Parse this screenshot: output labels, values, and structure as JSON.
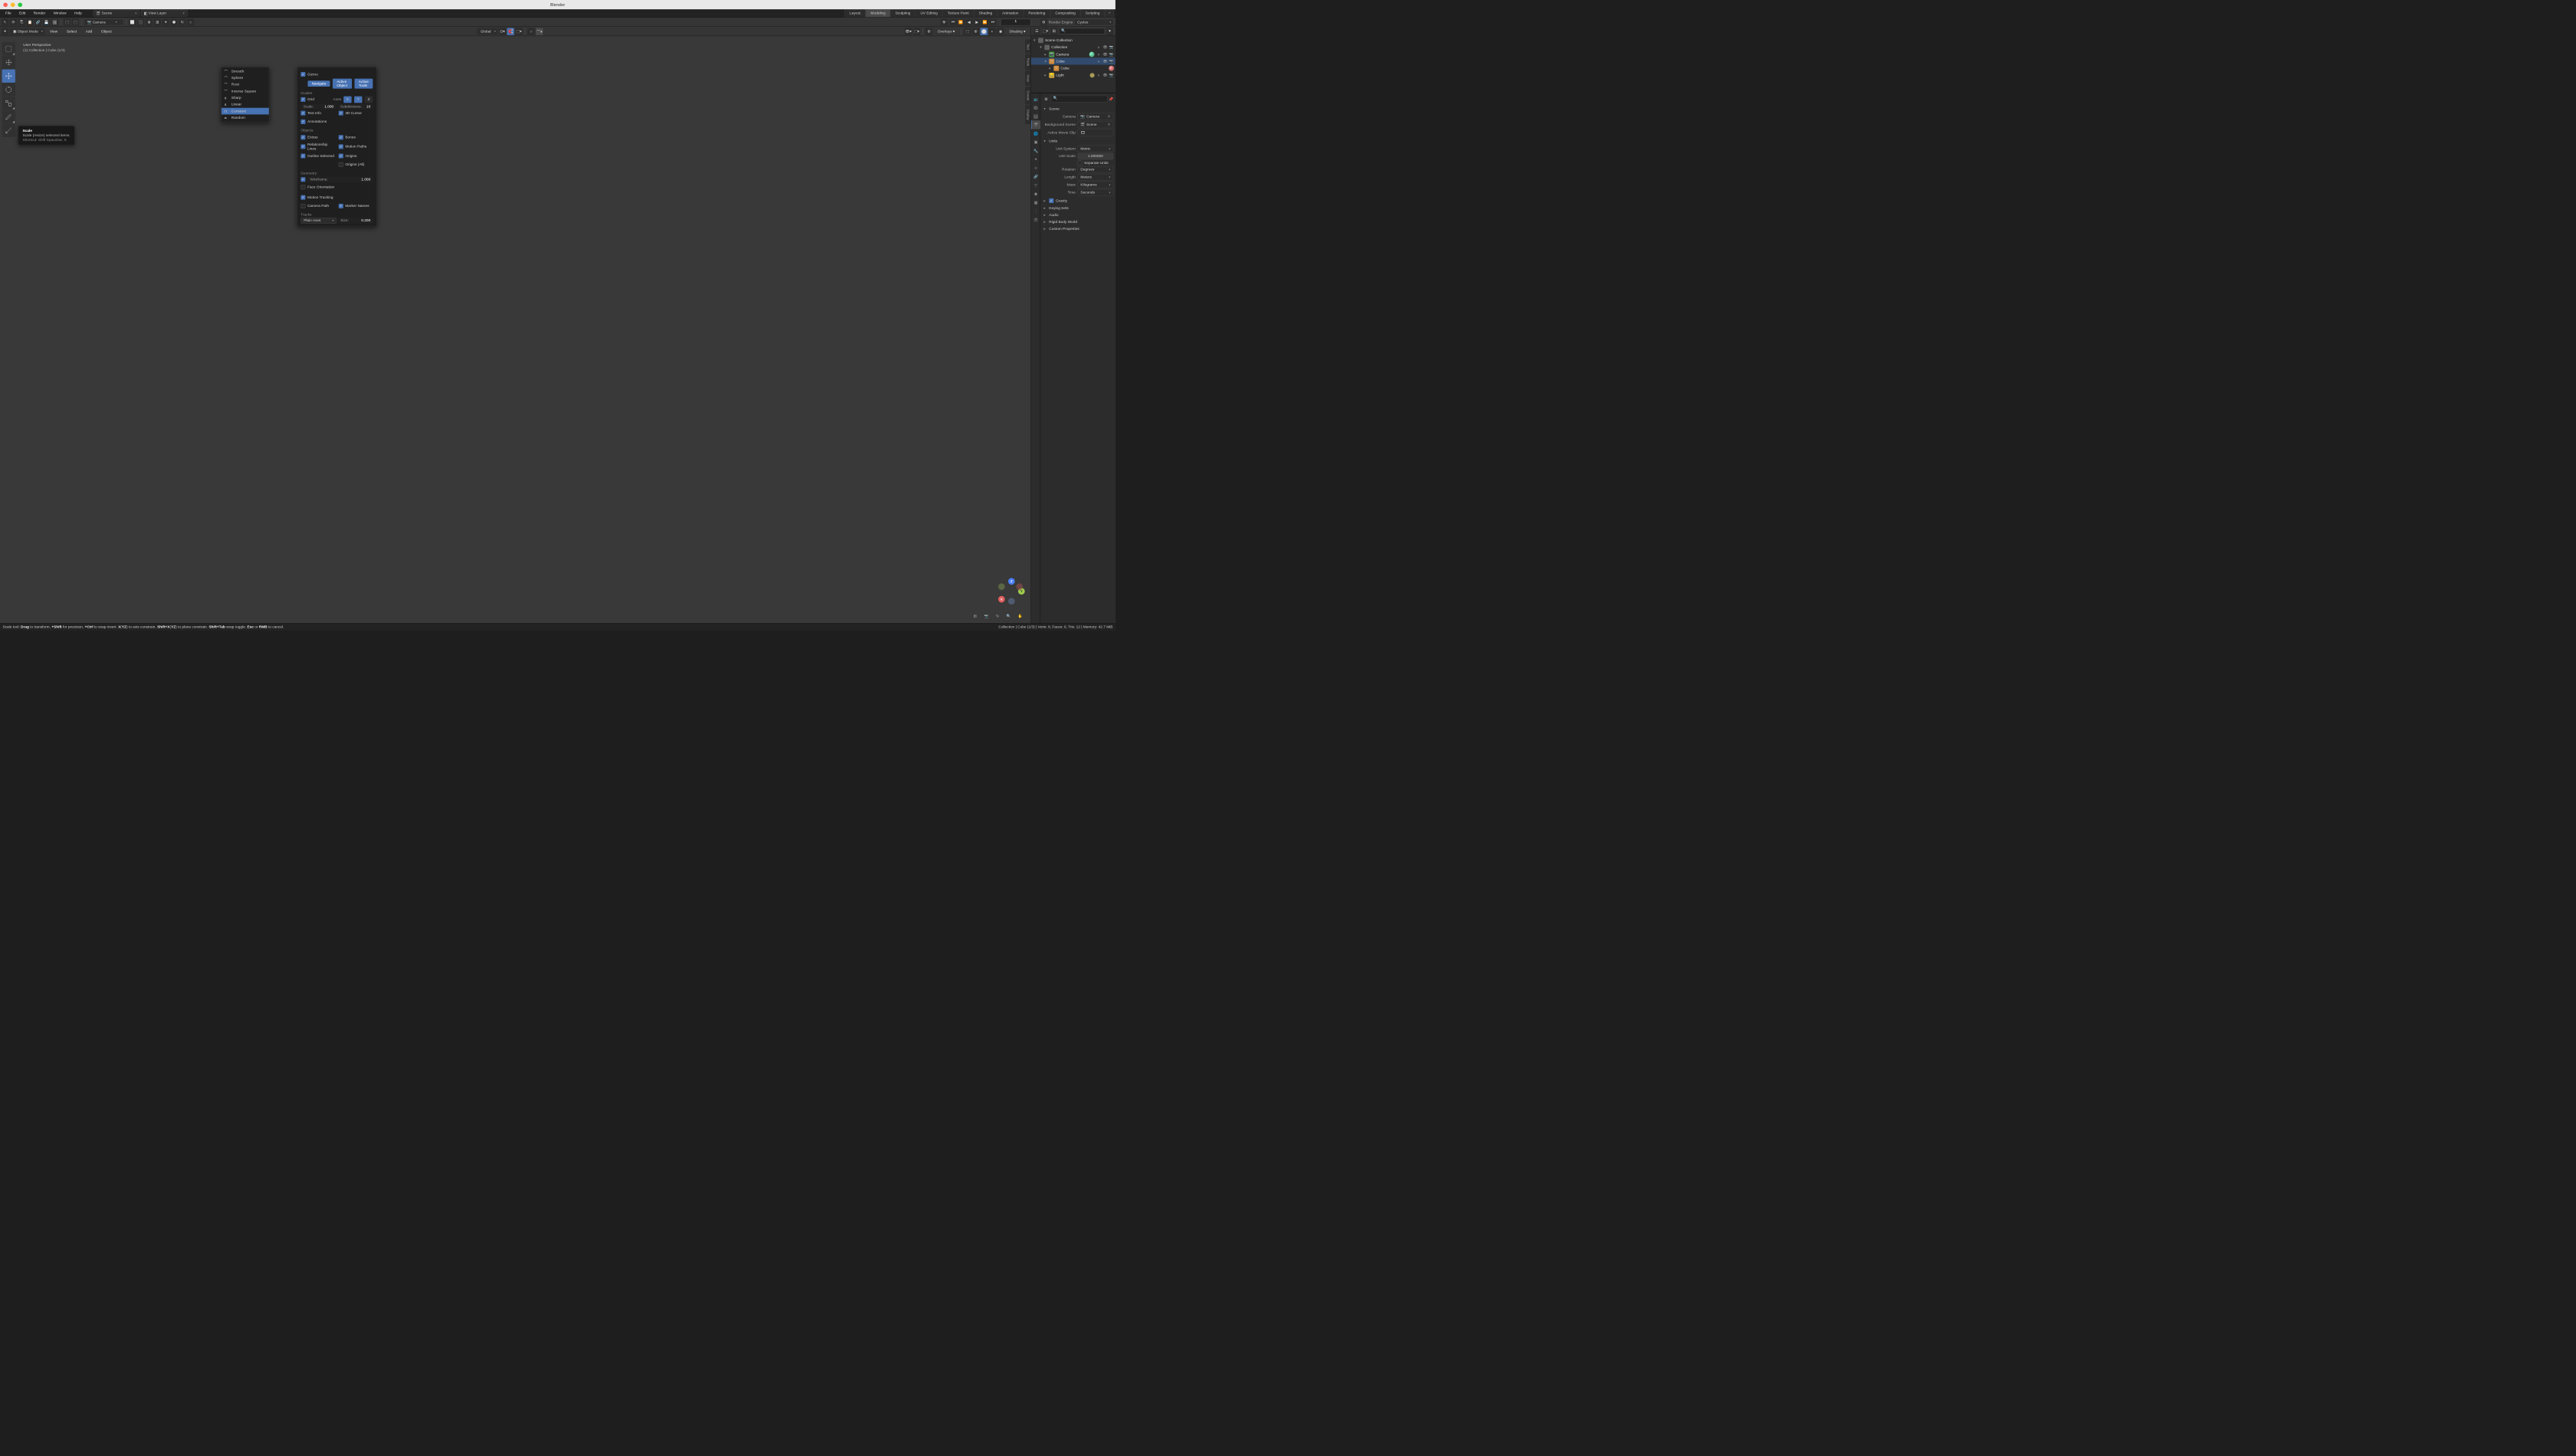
{
  "app_title": "Blender",
  "menu": [
    "File",
    "Edit",
    "Render",
    "Window",
    "Help"
  ],
  "scene": {
    "label": "Scene"
  },
  "view_layer": {
    "label": "View Layer"
  },
  "workspace_tabs": [
    "Layout",
    "Modeling",
    "Sculpting",
    "UV Editing",
    "Texture Paint",
    "Shading",
    "Animation",
    "Rendering",
    "Compositing",
    "Scripting"
  ],
  "active_workspace": "Modeling",
  "camera_dropdown": "Camera",
  "frame_current": "1",
  "render_engine_label": "Render Engine",
  "render_engine_value": "Cycles",
  "viewport_header": {
    "mode": "Object Mode",
    "menus": [
      "View",
      "Select",
      "Add",
      "Object"
    ],
    "orientation": "Global",
    "overlays_label": "Overlays",
    "shading_label": "Shading"
  },
  "vp_overlay": {
    "line1": "User Perspective",
    "line2": "(1) Collection | Cube (1/3)"
  },
  "tooltip": {
    "title": "Scale",
    "desc": "Scale (resize) selected items.",
    "shortcut": "Shortcut: Shift Spacebar, S"
  },
  "proportional_menu": [
    {
      "label": "Smooth",
      "key": "S"
    },
    {
      "label": "Sphere",
      "key": "S"
    },
    {
      "label": "Root",
      "key": "R"
    },
    {
      "label": "Inverse Square",
      "key": "I"
    },
    {
      "label": "Sharp",
      "key": "S"
    },
    {
      "label": "Linear",
      "key": "L"
    },
    {
      "label": "Constant",
      "key": "C",
      "selected": true
    },
    {
      "label": "Random",
      "key": "R"
    }
  ],
  "overlays": {
    "gizmo": "Gizmo",
    "gizmo_buttons": [
      "Navigate",
      "Active Object",
      "Active Tools"
    ],
    "guides": "Guides",
    "grid": "Grid",
    "axes_label": "Axes",
    "axes": {
      "X": true,
      "Y": true,
      "Z": false
    },
    "scale_label": "Scale:",
    "scale_value": "1.000",
    "subdiv_label": "Subdivisions:",
    "subdiv_value": "10",
    "text_info": "Text Info",
    "cursor3d": "3D Cursor",
    "annotations": "Annotations",
    "objects": "Objects",
    "extras": "Extras",
    "bones": "Bones",
    "relationship": "Relationship Lines",
    "motion_paths": "Motion Paths",
    "outline_sel": "Outline Selected",
    "origins": "Origins",
    "origins_all": "Origins (All)",
    "geometry": "Geometry",
    "wireframe": "Wireframe:",
    "wireframe_value": "1.000",
    "face_orientation": "Face Orientation",
    "motion_tracking": "Motion Tracking",
    "camera_path": "Camera Path",
    "marker_names": "Marker Names",
    "tracks": "Tracks",
    "tracks_value": "Plain Axes",
    "size_label": "Size:",
    "size_value": "0.200"
  },
  "side_tabs": [
    "Tool",
    "Redo",
    "View",
    "Create",
    "Display"
  ],
  "outliner": {
    "scene_collection": "Scene Collection",
    "collection": "Collection",
    "items": [
      {
        "name": "Camera",
        "type": "camera"
      },
      {
        "name": "Cube",
        "type": "mesh",
        "children": [
          {
            "name": "Cube",
            "type": "mesh_data"
          }
        ]
      },
      {
        "name": "Light",
        "type": "light"
      }
    ]
  },
  "properties": {
    "breadcrumb": "Scene",
    "camera_label": "Camera",
    "camera_value": "Camera",
    "bg_scene_label": "Background Scene",
    "bg_scene_value": "Scene",
    "movie_clip_label": "Active Movie Clip",
    "units": {
      "header": "Units",
      "system_label": "Unit System",
      "system_value": "Metric",
      "scale_label": "Unit Scale",
      "scale_value": "1.000000",
      "separate": "Separate Units",
      "rotation_label": "Rotation",
      "rotation_value": "Degrees",
      "length_label": "Length",
      "length_value": "Meters",
      "mass_label": "Mass",
      "mass_value": "Kilograms",
      "time_label": "Time",
      "time_value": "Seconds"
    },
    "gravity": "Gravity",
    "keying": "Keying Sets",
    "audio": "Audio",
    "rigid": "Rigid Body World",
    "custom": "Custom Properties"
  },
  "statusbar": {
    "left_html": "Scale tool: <b>Drag</b> to transform, <b>+Shift</b> for precision, <b>+Ctrl</b> to snap invert. <b>X</b>(<b>YZ</b>) to axis constrain, <b>Shift+X</b>(<b>YZ</b>) to plane constrain. <b>Shift+Tab</b> snap toggle. <b>Esc</b> or <b>RMB</b> to cancel.",
    "right": "Collection | Cube (1/3) | Verts: 8, Faces: 6, Tris: 12 | Memory: 42.7 MiB"
  }
}
